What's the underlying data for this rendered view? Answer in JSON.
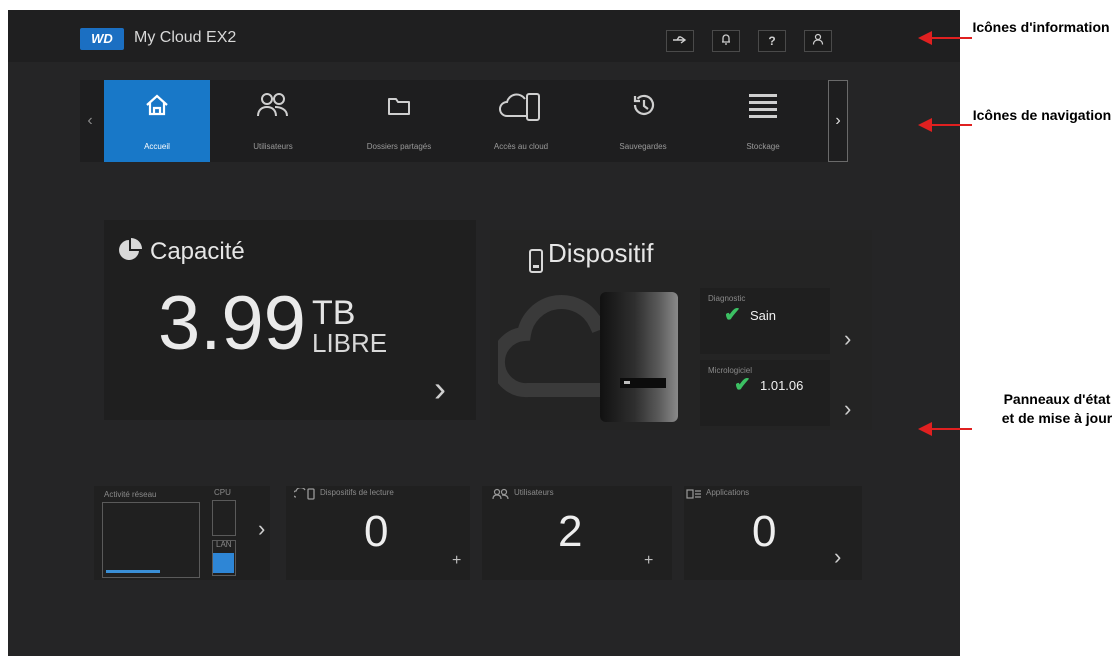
{
  "header": {
    "logo": "WD",
    "app_title": "My Cloud EX2",
    "icons": [
      "usb-icon",
      "bell-icon",
      "help-icon",
      "user-icon"
    ]
  },
  "nav": {
    "items": [
      {
        "label": "Accueil",
        "icon": "home-icon",
        "active": true
      },
      {
        "label": "Utilisateurs",
        "icon": "users-icon"
      },
      {
        "label": "Dossiers partagés",
        "icon": "folder-icon"
      },
      {
        "label": "Accès au cloud",
        "icon": "cloud-device-icon"
      },
      {
        "label": "Sauvegardes",
        "icon": "backup-icon"
      },
      {
        "label": "Stockage",
        "icon": "storage-icon"
      }
    ]
  },
  "capacity": {
    "title": "Capacité",
    "value": "3.99",
    "unit": "TB",
    "free_label": "LIBRE"
  },
  "device": {
    "title": "Dispositif",
    "diagnostics_label": "Diagnostic",
    "diagnostics_value": "Sain",
    "firmware_label": "Micrologiciel",
    "firmware_value": "1.01.06"
  },
  "widgets": {
    "network_label": "Activité réseau",
    "lan_label": "LAN",
    "cpu_label": "CPU",
    "usb_label": "Dispositifs de lecture",
    "usb_count": "0",
    "users_label": "Utilisateurs",
    "users_count": "2",
    "apps_label": "Applications",
    "apps_count": "0"
  },
  "annotations": {
    "info": "Icônes d'information",
    "nav": "Icônes de navigation",
    "panels": "Panneaux d'état et de mise à jour"
  },
  "colors": {
    "accent": "#1878c8",
    "ok": "#3cc063",
    "annotation": "#e02020"
  }
}
